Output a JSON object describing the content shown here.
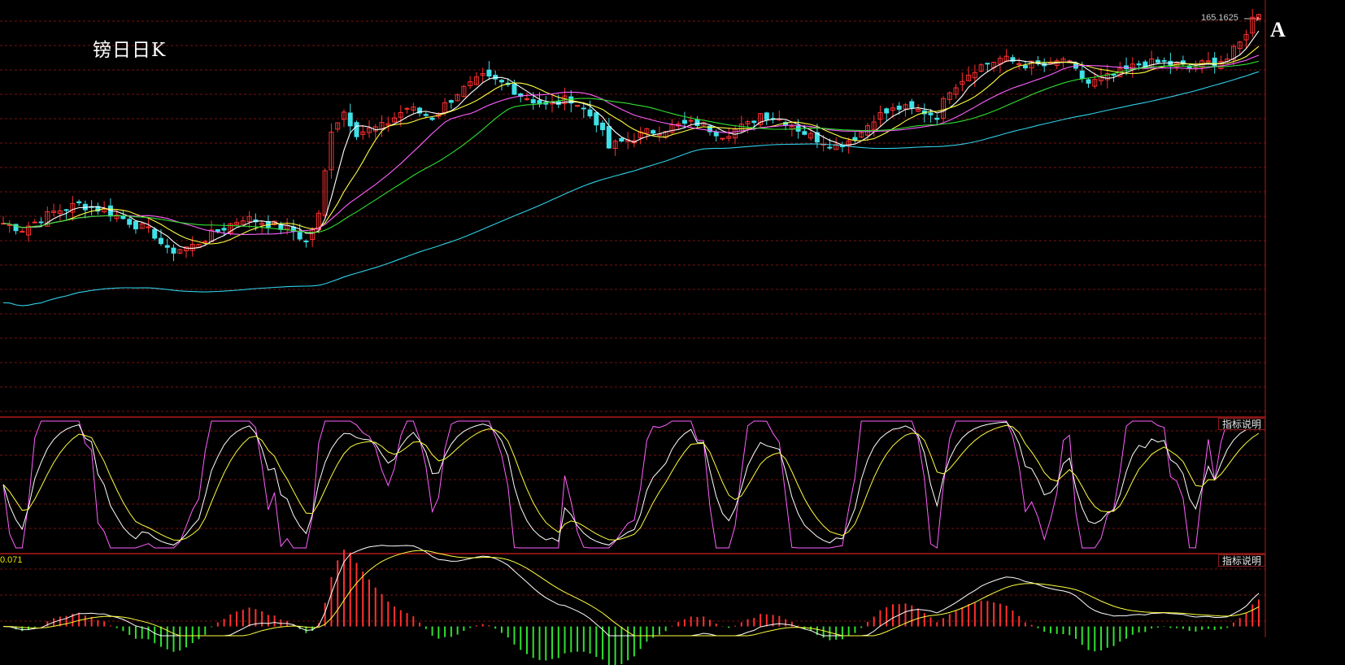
{
  "title": "镑日日K",
  "corner_label": "A",
  "indicator_button_1": "指标说明",
  "indicator_button_2": "指标说明",
  "macd_value_label": "0.071",
  "last_price_label": "165.1625",
  "colors": {
    "background": "#000000",
    "grid": "#7a1010",
    "panel_border": "#b01a1a",
    "candle_up": "#ff3030",
    "candle_down": "#40e0e8",
    "ma5": "#ffffff",
    "ma10": "#ffff40",
    "ma20": "#ff60ff",
    "ma30": "#30e030",
    "ma60": "#30d0e8",
    "kdj_k": "#ffffff",
    "kdj_d": "#ffff40",
    "kdj_j": "#ff60ff",
    "macd_pos": "#ff3030",
    "macd_neg": "#30e030"
  },
  "chart_data": {
    "type": "candlestick",
    "price_points": [
      [
        0,
        150.2
      ],
      [
        3,
        149.9
      ],
      [
        8,
        150.8
      ],
      [
        12,
        151.2
      ],
      [
        16,
        150.9
      ],
      [
        20,
        150.3
      ],
      [
        24,
        149.6
      ],
      [
        26,
        148.7
      ],
      [
        30,
        149.0
      ],
      [
        34,
        149.8
      ],
      [
        38,
        150.5
      ],
      [
        42,
        150.2
      ],
      [
        46,
        149.8
      ],
      [
        48,
        149.2
      ],
      [
        50,
        150.6
      ],
      [
        52,
        155.2
      ],
      [
        54,
        156.1
      ],
      [
        56,
        155.0
      ],
      [
        60,
        155.3
      ],
      [
        64,
        156.3
      ],
      [
        68,
        155.8
      ],
      [
        72,
        157.1
      ],
      [
        76,
        157.9
      ],
      [
        80,
        157.5
      ],
      [
        82,
        157.0
      ],
      [
        86,
        156.4
      ],
      [
        90,
        156.8
      ],
      [
        94,
        155.6
      ],
      [
        96,
        154.2
      ],
      [
        98,
        154.5
      ],
      [
        102,
        155.0
      ],
      [
        106,
        155.3
      ],
      [
        110,
        155.5
      ],
      [
        114,
        154.9
      ],
      [
        118,
        155.4
      ],
      [
        120,
        156.0
      ],
      [
        124,
        155.6
      ],
      [
        128,
        154.8
      ],
      [
        132,
        154.3
      ],
      [
        134,
        154.6
      ],
      [
        136,
        155.0
      ],
      [
        138,
        155.8
      ],
      [
        142,
        156.3
      ],
      [
        146,
        156.1
      ],
      [
        148,
        155.9
      ],
      [
        150,
        157.3
      ],
      [
        154,
        158.4
      ],
      [
        158,
        158.9
      ],
      [
        162,
        158.6
      ],
      [
        166,
        158.5
      ],
      [
        168,
        158.9
      ],
      [
        170,
        158.2
      ],
      [
        172,
        157.6
      ],
      [
        176,
        158.0
      ],
      [
        180,
        158.6
      ],
      [
        184,
        158.7
      ],
      [
        188,
        158.4
      ],
      [
        190,
        158.6
      ],
      [
        194,
        158.9
      ],
      [
        196,
        159.7
      ],
      [
        198,
        161.0
      ],
      [
        199,
        161.4
      ]
    ],
    "x_count": 200,
    "y_range": [
      140,
      162
    ],
    "kdj_range": [
      0,
      100
    ],
    "macd_range": [
      -0.2,
      1.2
    ],
    "last_price": 165.1625
  }
}
